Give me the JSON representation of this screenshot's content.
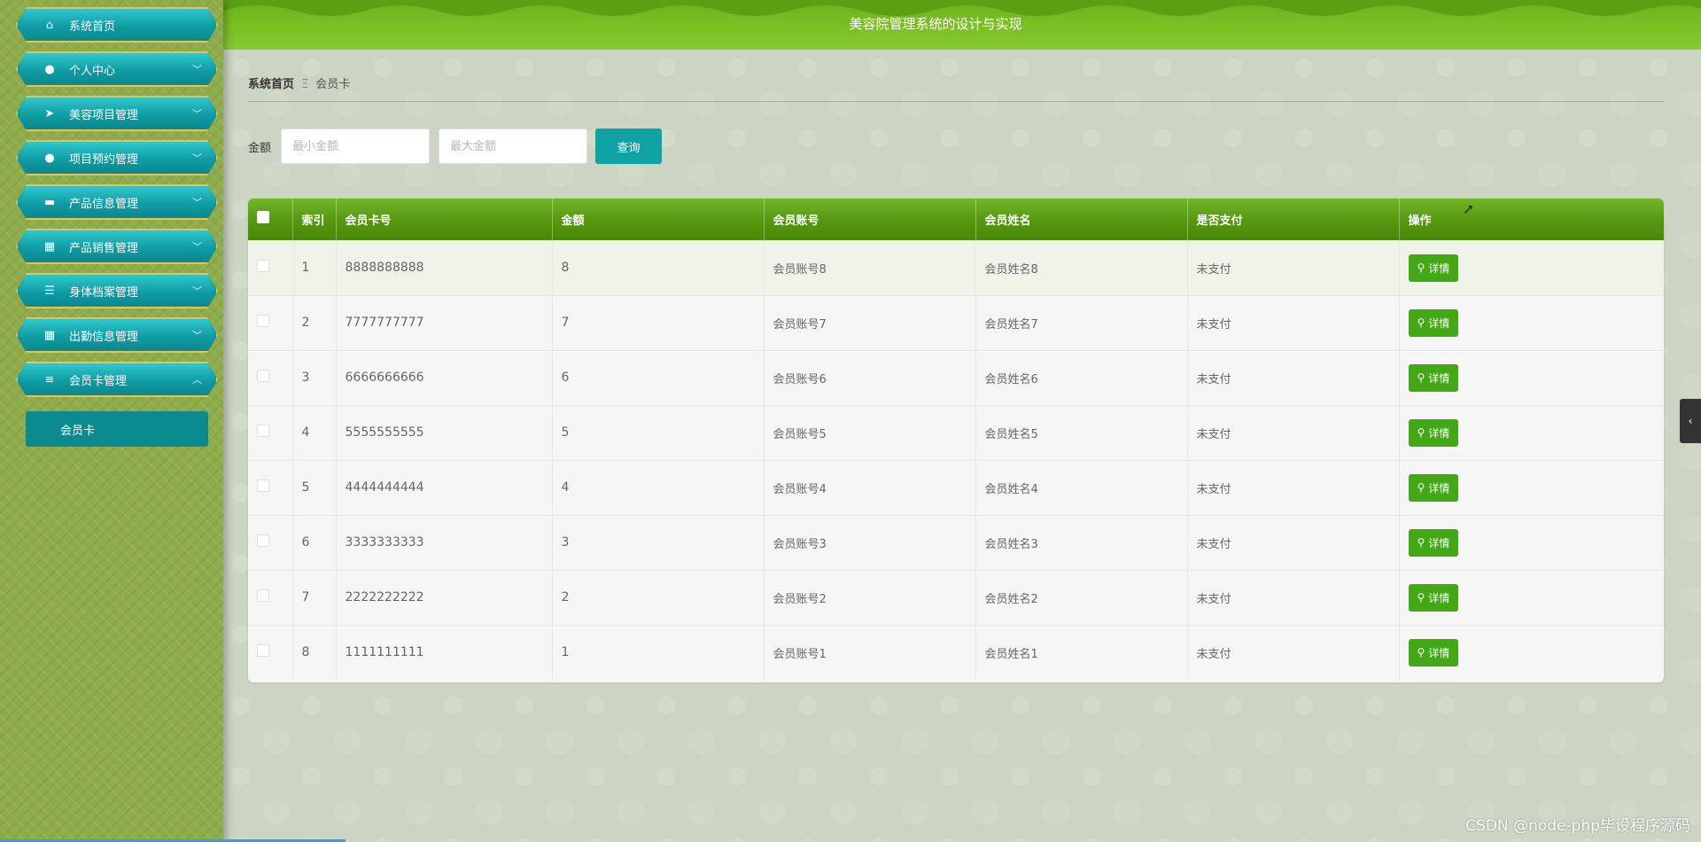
{
  "header": {
    "title": "美容院管理系统的设计与实现"
  },
  "sidebar": {
    "items": [
      {
        "label": "系统首页",
        "icon": "home-icon",
        "glyph": "⌂",
        "chevron": ""
      },
      {
        "label": "个人中心",
        "icon": "user-icon",
        "glyph": "●",
        "chevron": "﹀"
      },
      {
        "label": "美容项目管理",
        "icon": "paper-plane-icon",
        "glyph": "➤",
        "chevron": "﹀"
      },
      {
        "label": "项目预约管理",
        "icon": "bulb-icon",
        "glyph": "●",
        "chevron": "﹀"
      },
      {
        "label": "产品信息管理",
        "icon": "ticket-icon",
        "glyph": "▬",
        "chevron": "﹀"
      },
      {
        "label": "产品销售管理",
        "icon": "grid-icon",
        "glyph": "▦",
        "chevron": "﹀"
      },
      {
        "label": "身体档案管理",
        "icon": "sliders-icon",
        "glyph": "☰",
        "chevron": "﹀"
      },
      {
        "label": "出勤信息管理",
        "icon": "grid-icon",
        "glyph": "▦",
        "chevron": "﹀"
      },
      {
        "label": "会员卡管理",
        "icon": "list-icon",
        "glyph": "≡",
        "chevron": "︿"
      }
    ],
    "submenu": {
      "label": "会员卡"
    }
  },
  "breadcrumb": {
    "home": "系统首页",
    "separator": "Ξ",
    "current": "会员卡"
  },
  "filter": {
    "label": "金额",
    "min_placeholder": "最小金额",
    "max_placeholder": "最大金额",
    "search_label": "查询"
  },
  "table": {
    "columns": [
      "索引",
      "会员卡号",
      "金额",
      "会员账号",
      "会员姓名",
      "是否支付",
      "操作"
    ],
    "rows": [
      {
        "index": "1",
        "card": "8888888888",
        "amount": "8",
        "account": "会员账号8",
        "name": "会员姓名8",
        "paid": "未支付"
      },
      {
        "index": "2",
        "card": "7777777777",
        "amount": "7",
        "account": "会员账号7",
        "name": "会员姓名7",
        "paid": "未支付"
      },
      {
        "index": "3",
        "card": "6666666666",
        "amount": "6",
        "account": "会员账号6",
        "name": "会员姓名6",
        "paid": "未支付"
      },
      {
        "index": "4",
        "card": "5555555555",
        "amount": "5",
        "account": "会员账号5",
        "name": "会员姓名5",
        "paid": "未支付"
      },
      {
        "index": "5",
        "card": "4444444444",
        "amount": "4",
        "account": "会员账号4",
        "name": "会员姓名4",
        "paid": "未支付"
      },
      {
        "index": "6",
        "card": "3333333333",
        "amount": "3",
        "account": "会员账号3",
        "name": "会员姓名3",
        "paid": "未支付"
      },
      {
        "index": "7",
        "card": "2222222222",
        "amount": "2",
        "account": "会员账号2",
        "name": "会员姓名2",
        "paid": "未支付"
      },
      {
        "index": "8",
        "card": "1111111111",
        "amount": "1",
        "account": "会员账号1",
        "name": "会员姓名1",
        "paid": "未支付"
      }
    ],
    "detail_label": "详情"
  },
  "watermark": "CSDN @node-php毕设程序源码",
  "colors": {
    "header": "#7dc125",
    "sidebar": "#8fac4a",
    "menu_teal": "#0e9da3",
    "table_header": "#55960f",
    "detail_button": "#43a816",
    "search_button": "#0fa3a6"
  }
}
